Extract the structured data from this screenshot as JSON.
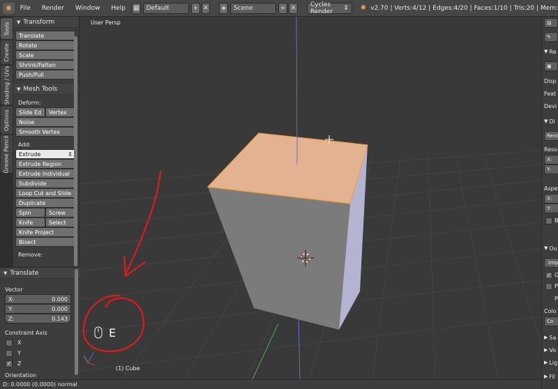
{
  "topbar": {
    "menus": [
      "File",
      "Render",
      "Window",
      "Help"
    ],
    "screen_layout": "Default",
    "scene": "Scene",
    "render_engine": "Cycles Render",
    "stats": "v2.70 | Verts:4/12 | Edges:4/20 | Faces:1/10 | Tris:20 | Mem:"
  },
  "tabs": [
    "Tools",
    "Create",
    "Shading / UVs",
    "Options",
    "Grease Pencil"
  ],
  "toolshelf": {
    "transform_title": "Transform",
    "transform_buttons": [
      "Translate",
      "Rotate",
      "Scale",
      "Shrink/Fatten",
      "Push/Pull"
    ],
    "mesh_tools_title": "Mesh Tools",
    "deform_label": "Deform:",
    "slide_edge": "Slide Ed",
    "vertex": "Vertex",
    "noise": "Noise",
    "smooth_vertex": "Smooth Vertex",
    "add_label": "Add:",
    "extrude": "Extrude",
    "extrude_region": "Extrude Region",
    "extrude_individual": "Extrude Individual",
    "subdivide": "Subdivide",
    "loop_cut": "Loop Cut and Slide",
    "duplicate": "Duplicate",
    "spin": "Spin",
    "screw": "Screw",
    "knife": "Knife",
    "select": "Select",
    "knife_project": "Knife Project",
    "bisect": "Bisect",
    "remove_label": "Remove:"
  },
  "operator": {
    "title": "Translate",
    "vector_label": "Vector",
    "x_label": "X:",
    "x_value": "0.000",
    "y_label": "Y:",
    "y_value": "0.000",
    "z_label": "Z:",
    "z_value": "0.143",
    "constraint_label": "Constraint Axis",
    "axes": [
      {
        "label": "X",
        "checked": false
      },
      {
        "label": "Y",
        "checked": false
      },
      {
        "label": "Z",
        "checked": true
      }
    ],
    "orientation_label": "Orientation"
  },
  "viewport": {
    "view_label": "User Persp",
    "object_label": "(1) Cube",
    "key_label": "E",
    "top_face_color": "#e3b391",
    "annotation_color": "#e11b1b"
  },
  "statusbar": {
    "text": "D: 0.0000 (0.0000) normal"
  },
  "props": {
    "rows": [
      "Re",
      "Disp",
      "Feat",
      "Devi",
      "Di",
      "Rend",
      "Reso",
      "X:",
      "Y:",
      "Aspe",
      "X:",
      "Y:",
      "B",
      "Ou",
      ".tmp",
      "O",
      "P",
      "P",
      "Colo",
      "Co",
      "Sa",
      "Vo",
      "Lig",
      "Fil"
    ]
  }
}
